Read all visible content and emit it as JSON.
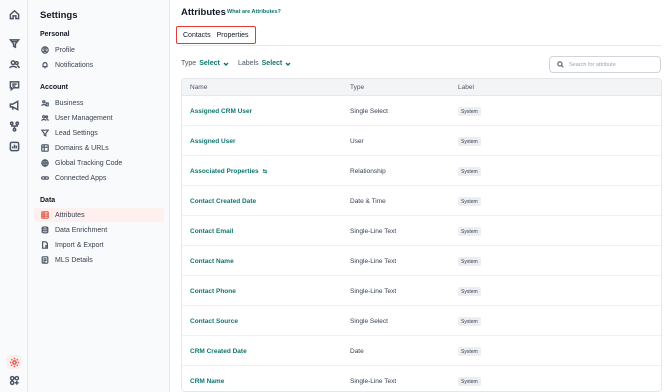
{
  "rail": {
    "icons": [
      "home-icon",
      "filter-funnel-icon",
      "contacts-icon",
      "chat-icon",
      "megaphone-icon",
      "workflow-icon",
      "reports-icon"
    ],
    "bottom_icons": [
      "settings-gear-icon",
      "apps-grid-icon"
    ],
    "accent": "#e2574c"
  },
  "sidebar": {
    "title": "Settings",
    "sections": [
      {
        "label": "Personal",
        "items": [
          {
            "label": "Profile",
            "icon": "user-circle-icon"
          },
          {
            "label": "Notifications",
            "icon": "bell-icon"
          }
        ]
      },
      {
        "label": "Account",
        "items": [
          {
            "label": "Business",
            "icon": "briefcase-icon"
          },
          {
            "label": "User Management",
            "icon": "users-icon"
          },
          {
            "label": "Lead Settings",
            "icon": "funnel-icon"
          },
          {
            "label": "Domains & URLs",
            "icon": "globe-grid-icon"
          },
          {
            "label": "Global Tracking Code",
            "icon": "globe-icon"
          },
          {
            "label": "Connected Apps",
            "icon": "link-icon"
          }
        ]
      },
      {
        "label": "Data",
        "items": [
          {
            "label": "Attributes",
            "icon": "table-icon",
            "active": true
          },
          {
            "label": "Data Enrichment",
            "icon": "database-icon"
          },
          {
            "label": "Import & Export",
            "icon": "file-export-icon"
          },
          {
            "label": "MLS Details",
            "icon": "mls-doc-icon"
          }
        ]
      }
    ]
  },
  "main": {
    "title": "Attributes",
    "help_link": "What are Attributes?",
    "tabs": [
      {
        "label": "Contacts"
      },
      {
        "label": "Properties"
      }
    ],
    "filters": {
      "type_label": "Type",
      "type_value": "Select",
      "labels_label": "Labels",
      "labels_value": "Select"
    },
    "search": {
      "placeholder": "Search for attribute",
      "value": ""
    },
    "table": {
      "columns": [
        "Name",
        "Type",
        "Label"
      ],
      "rows": [
        {
          "name": "Assigned CRM User",
          "type": "Single Select",
          "label": "System"
        },
        {
          "name": "Assigned User",
          "type": "User",
          "label": "System"
        },
        {
          "name": "Associated Properties",
          "type": "Relationship",
          "label": "System",
          "rel_icon": true
        },
        {
          "name": "Contact Created Date",
          "type": "Date & Time",
          "label": "System"
        },
        {
          "name": "Contact Email",
          "type": "Single-Line Text",
          "label": "System"
        },
        {
          "name": "Contact Name",
          "type": "Single-Line Text",
          "label": "System"
        },
        {
          "name": "Contact Phone",
          "type": "Single-Line Text",
          "label": "System"
        },
        {
          "name": "Contact Source",
          "type": "Single Select",
          "label": "System"
        },
        {
          "name": "CRM Created Date",
          "type": "Date",
          "label": "System"
        },
        {
          "name": "CRM Name",
          "type": "Single-Line Text",
          "label": "System"
        }
      ]
    },
    "link_color": "#0f766e",
    "highlight_color": "#e53935"
  }
}
